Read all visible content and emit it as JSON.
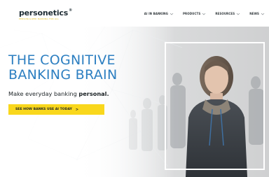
{
  "brand": {
    "name": "personetics",
    "registered": "®",
    "tagline": "PERSONALIZED BANKING FOR ALL"
  },
  "nav": {
    "items": [
      {
        "label": "AI IN BANKING"
      },
      {
        "label": "PRODUCTS"
      },
      {
        "label": "RESOURCES"
      },
      {
        "label": "NEWS"
      }
    ]
  },
  "hero": {
    "headline_line1": "THE COGNITIVE",
    "headline_line2": "BANKING BRAIN",
    "sub_text": "Make everyday banking ",
    "sub_bold": "personal.",
    "cta_label": "SEE HOW BANKS USE AI TODAY",
    "cta_arrow": ">"
  },
  "colors": {
    "accent_blue": "#2d7fc1",
    "cta_yellow": "#f9d71c",
    "nav_text": "#30373b"
  },
  "icons": [
    "chevron-down-icon",
    "network-pattern",
    "person-photo"
  ]
}
